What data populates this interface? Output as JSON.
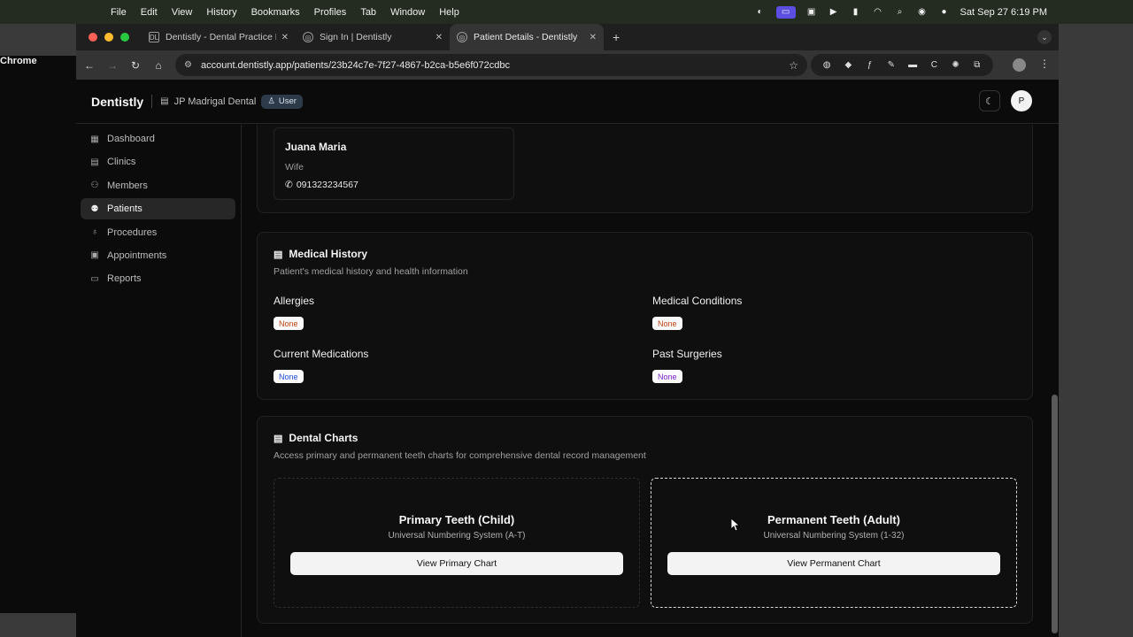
{
  "menubar": {
    "items": [
      "Chrome",
      "File",
      "Edit",
      "View",
      "History",
      "Bookmarks",
      "Profiles",
      "Tab",
      "Window",
      "Help"
    ],
    "datetime": "Sat Sep 27  6:19 PM"
  },
  "browser": {
    "tabs": [
      {
        "title": "Dentistly - Dental Practice Ma",
        "favicon": "DL"
      },
      {
        "title": "Sign In | Dentistly",
        "favicon": "globe"
      },
      {
        "title": "Patient Details - Dentistly",
        "favicon": "globe"
      }
    ],
    "url": "account.dentistly.app/patients/23b24c7e-7f27-4867-b2ca-b5e6f072cdbc"
  },
  "app": {
    "brand": "Dentistly",
    "clinic": "JP Madrigal Dental",
    "role": "User",
    "avatar_initial": "P"
  },
  "sidebar": {
    "items": [
      {
        "label": "Dashboard",
        "icon": "grid-icon"
      },
      {
        "label": "Clinics",
        "icon": "building-icon"
      },
      {
        "label": "Members",
        "icon": "users-icon"
      },
      {
        "label": "Patients",
        "icon": "patients-icon",
        "active": true
      },
      {
        "label": "Procedures",
        "icon": "stethoscope-icon"
      },
      {
        "label": "Appointments",
        "icon": "calendar-icon"
      },
      {
        "label": "Reports",
        "icon": "report-icon"
      }
    ]
  },
  "emergency_contact": {
    "name": "Juana Maria",
    "relation": "Wife",
    "phone": "091323234567"
  },
  "medical_history": {
    "title": "Medical History",
    "subtitle": "Patient's medical history and health information",
    "allergies_label": "Allergies",
    "allergies_value": "None",
    "conditions_label": "Medical Conditions",
    "conditions_value": "None",
    "medications_label": "Current Medications",
    "medications_value": "None",
    "surgeries_label": "Past Surgeries",
    "surgeries_value": "None"
  },
  "dental_charts": {
    "title": "Dental Charts",
    "subtitle": "Access primary and permanent teeth charts for comprehensive dental record management",
    "primary": {
      "title": "Primary Teeth (Child)",
      "subtitle": "Universal Numbering System (A-T)",
      "button": "View Primary Chart"
    },
    "permanent": {
      "title": "Permanent Teeth (Adult)",
      "subtitle": "Universal Numbering System (1-32)",
      "button": "View Permanent Chart"
    }
  }
}
